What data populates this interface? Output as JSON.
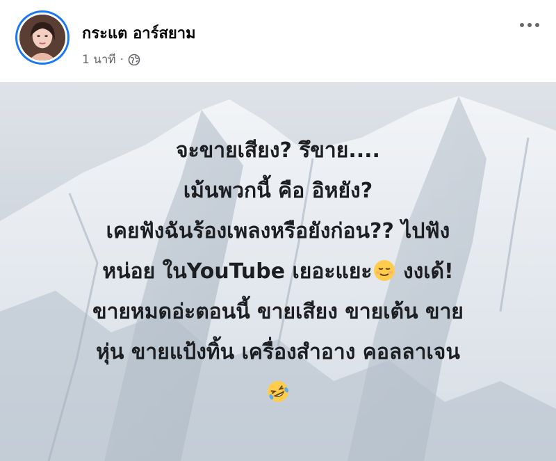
{
  "author": {
    "name": "กระแต อาร์สยาม"
  },
  "meta": {
    "time": "1 นาที",
    "separator": "·",
    "privacy_icon": "globe-icon"
  },
  "post": {
    "background": "snowy-mountain",
    "lines": [
      "จะขายเสียง? รึขาย....",
      "เม้นพวกนี้ คือ อิหยัง?",
      "เคยฟังฉันร้องเพลงหรือยังก่อน?? ไปฟัง",
      "หน่อย ในYouTube เยอะแยะ",
      "งงเด้!",
      "ขายหมดอ่ะตอนนี้ ขายเสียง ขายเต้น ขาย",
      "หุ่น ขายแป้งทิ้น เครื่องสำอาง คอลลาเจน"
    ],
    "emojis": [
      "relieved-face-emoji",
      "rolling-laughing-emoji"
    ]
  },
  "colors": {
    "accent": "#1877f2",
    "text": "#1c1e21",
    "muted": "#65676b"
  }
}
